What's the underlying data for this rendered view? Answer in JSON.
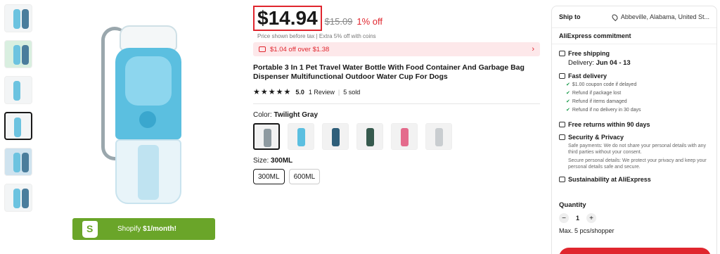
{
  "gallery": {
    "thumb_count": 7,
    "active_index": 3
  },
  "promo": {
    "brand": "Shopify",
    "offer": "$1/month!"
  },
  "price": {
    "current": "$14.94",
    "original": "$15.09",
    "discount": "1% off",
    "note": "Price shown before tax  |  Extra 5% off with coins"
  },
  "coupon": {
    "text": "$1.04 off over $1.38",
    "chevron": "›"
  },
  "product": {
    "title": "Portable 3 In 1 Pet Travel Water Bottle With Food Container And Garbage Bag Dispenser Multifunctional Outdoor Water Cup For Dogs",
    "stars": "★★★★★",
    "rating": "5.0",
    "reviews": "1 Review",
    "sold": "5 sold"
  },
  "color": {
    "label": "Color: ",
    "selected": "Twilight Gray",
    "swatches": [
      "#8e9aa0",
      "#5bbfe0",
      "#2f5f7a",
      "#365a4e",
      "#e46b8c",
      "#c9cdd0"
    ]
  },
  "size": {
    "label": "Size: ",
    "selected": "300ML",
    "options": [
      "300ML",
      "600ML"
    ]
  },
  "shipping": {
    "label": "Ship to",
    "location": "Abbeville, Alabama, United St...",
    "commitment": "AliExpress commitment",
    "free_shipping": "Free shipping",
    "delivery_prefix": "Delivery: ",
    "delivery_dates": "Jun 04 - 13",
    "fast_delivery": "Fast delivery",
    "fast_items": [
      "$1.00 coupon code if delayed",
      "Refund if package lost",
      "Refund if items damaged",
      "Refund if no delivery in 30 days"
    ],
    "returns": "Free returns within 90 days",
    "security": "Security & Privacy",
    "security_text_1": "Safe payments: We do not share your personal details with any third parties without your consent.",
    "security_text_2": "Secure personal details: We protect your privacy and keep your personal details safe and secure.",
    "sustainability": "Sustainability at AliExpress"
  },
  "quantity": {
    "label": "Quantity",
    "value": "1",
    "minus": "−",
    "plus": "+",
    "max": "Max. 5 pcs/shopper"
  },
  "colors": {
    "accent": "#e0262e",
    "shopify": "#6aa529",
    "check": "#1a9b4b"
  }
}
